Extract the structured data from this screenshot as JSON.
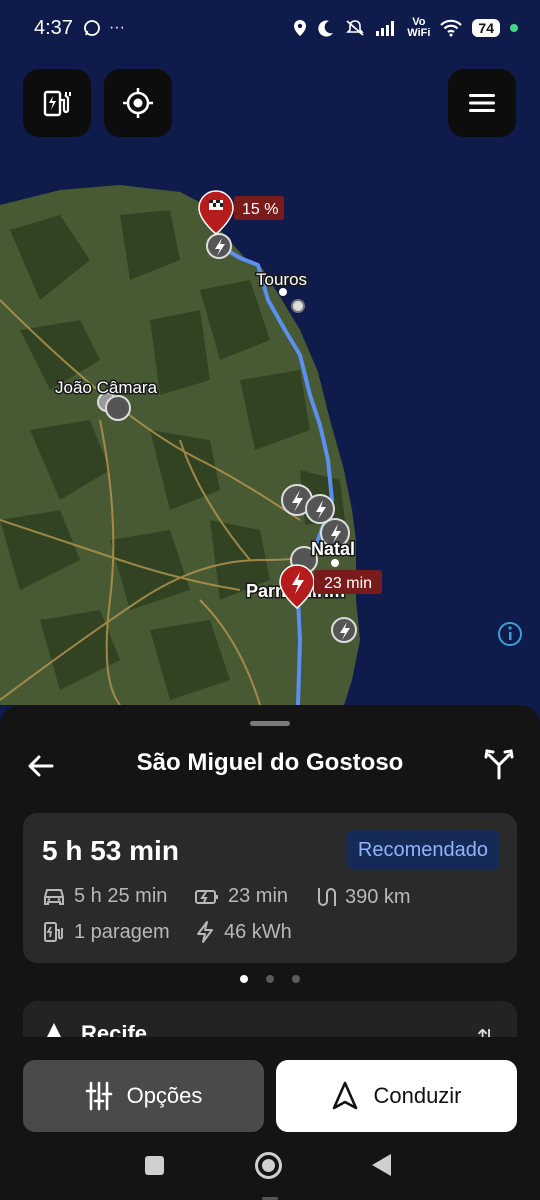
{
  "status_bar": {
    "time": "4:37",
    "battery": "74",
    "network_label_top": "Vo",
    "network_label_bottom": "WiFi"
  },
  "map": {
    "places": [
      "Touros",
      "João Câmara",
      "Natal",
      "Parnamirim"
    ],
    "destination_marker_label": "15 %",
    "charging_stop_marker_label": "23 min",
    "route_color": "#5b8ff0",
    "marker_color": "#b71c1c"
  },
  "map_buttons": {
    "charger_icon": "ev-station-icon",
    "locate_icon": "gps-target-icon",
    "menu_icon": "hamburger-menu-icon"
  },
  "sheet": {
    "destination": "São Miguel do Gostoso",
    "route": {
      "total_time": "5 h 53 min",
      "badge": "Recomendado",
      "drive_time": "5 h 25 min",
      "charge_time": "23 min",
      "distance": "390 km",
      "stops": "1 paragem",
      "energy": "46 kWh"
    },
    "pager": {
      "count": 3,
      "active": 0
    },
    "next_stop_label": "Recife"
  },
  "actions": {
    "options_label": "Opções",
    "drive_label": "Conduzir"
  },
  "colors": {
    "sheet_bg": "#141414",
    "card_bg": "#2a2a2a",
    "badge_bg": "#152a55",
    "badge_text": "#8fb3ff",
    "ocean": "#0f1b4a",
    "land": "#4a5a34"
  }
}
